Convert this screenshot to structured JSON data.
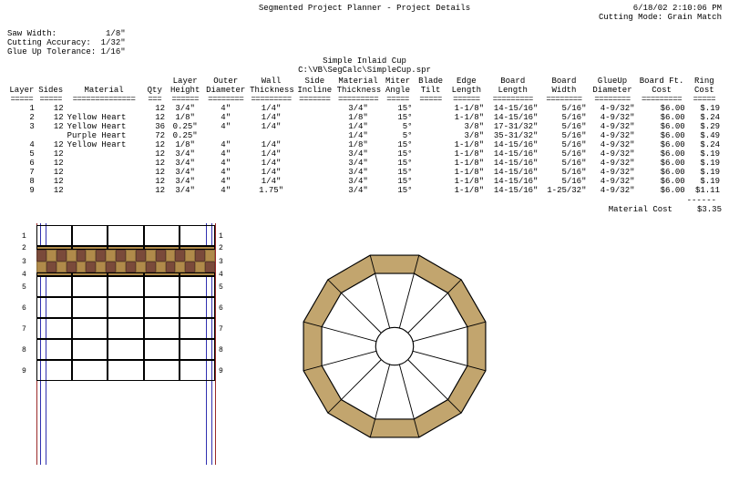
{
  "header": {
    "title": "Segmented Project Planner - Project Details",
    "datetime": "6/18/02 2:10:06 PM",
    "cutting_mode_label": "Cutting Mode:",
    "cutting_mode": "Grain Match",
    "saw_width_label": "Saw Width:",
    "saw_width": "1/8\"",
    "cut_acc_label": "Cutting Accuracy:",
    "cut_acc": "1/32\"",
    "glue_tol_label": "Glue Up Tolerance:",
    "glue_tol": "1/16\"",
    "proj_name": "Simple Inlaid Cup",
    "proj_path": "C:\\VB\\SegCalc\\SimpleCup.spr"
  },
  "columns": {
    "h1": [
      "",
      "",
      "",
      "",
      "Layer",
      "Outer",
      "Wall",
      "Side",
      "Material",
      "Miter",
      "Blade",
      "Edge",
      "Board",
      "Board",
      "GlueUp",
      "Board Ft.",
      "Ring"
    ],
    "h2": [
      "Layer",
      "Sides",
      "Material",
      "Qty",
      "Height",
      "Diameter",
      "Thickness",
      "Incline",
      "Thickness",
      "Angle",
      "Tilt",
      "Length",
      "Length",
      "Width",
      "Diameter",
      "Cost",
      "Cost"
    ]
  },
  "dashes": [
    "=====",
    "=====",
    "==============",
    "===",
    "======",
    "========",
    "=========",
    "=======",
    "=========",
    "=====",
    "=====",
    "======",
    "=========",
    "========",
    "========",
    "=========",
    "====="
  ],
  "rows": [
    {
      "c": [
        "1",
        "12",
        "",
        "12",
        "3/4\"",
        "4\"",
        "1/4\"",
        "",
        "3/4\"",
        "15°",
        "",
        "1-1/8\"",
        "14-15/16\"",
        "5/16\"",
        "4-9/32\"",
        "$6.00",
        "$.19"
      ]
    },
    {
      "c": [
        "2",
        "12",
        "Yellow Heart",
        "12",
        "1/8\"",
        "4\"",
        "1/4\"",
        "",
        "1/8\"",
        "15°",
        "",
        "1-1/8\"",
        "14-15/16\"",
        "5/16\"",
        "4-9/32\"",
        "$6.00",
        "$.24"
      ]
    },
    {
      "c": [
        "3",
        "12",
        "Yellow Heart",
        "36",
        "0.25\"",
        "4\"",
        "1/4\"",
        "",
        "1/4\"",
        "5°",
        "",
        "3/8\"",
        "17-31/32\"",
        "5/16\"",
        "4-9/32\"",
        "$6.00",
        "$.29"
      ]
    },
    {
      "c": [
        "",
        "",
        "Purple Heart",
        "72",
        "0.25\"",
        "",
        "",
        "",
        "1/4\"",
        "5°",
        "",
        "3/8\"",
        "35-31/32\"",
        "5/16\"",
        "4-9/32\"",
        "$6.00",
        "$.49"
      ]
    },
    {
      "c": [
        "4",
        "12",
        "Yellow Heart",
        "12",
        "1/8\"",
        "4\"",
        "1/4\"",
        "",
        "1/8\"",
        "15°",
        "",
        "1-1/8\"",
        "14-15/16\"",
        "5/16\"",
        "4-9/32\"",
        "$6.00",
        "$.24"
      ]
    },
    {
      "c": [
        "5",
        "12",
        "",
        "12",
        "3/4\"",
        "4\"",
        "1/4\"",
        "",
        "3/4\"",
        "15°",
        "",
        "1-1/8\"",
        "14-15/16\"",
        "5/16\"",
        "4-9/32\"",
        "$6.00",
        "$.19"
      ]
    },
    {
      "c": [
        "6",
        "12",
        "",
        "12",
        "3/4\"",
        "4\"",
        "1/4\"",
        "",
        "3/4\"",
        "15°",
        "",
        "1-1/8\"",
        "14-15/16\"",
        "5/16\"",
        "4-9/32\"",
        "$6.00",
        "$.19"
      ]
    },
    {
      "c": [
        "7",
        "12",
        "",
        "12",
        "3/4\"",
        "4\"",
        "1/4\"",
        "",
        "3/4\"",
        "15°",
        "",
        "1-1/8\"",
        "14-15/16\"",
        "5/16\"",
        "4-9/32\"",
        "$6.00",
        "$.19"
      ]
    },
    {
      "c": [
        "8",
        "12",
        "",
        "12",
        "3/4\"",
        "4\"",
        "1/4\"",
        "",
        "3/4\"",
        "15°",
        "",
        "1-1/8\"",
        "14-15/16\"",
        "5/16\"",
        "4-9/32\"",
        "$6.00",
        "$.19"
      ]
    },
    {
      "c": [
        "9",
        "12",
        "",
        "12",
        "3/4\"",
        "4\"",
        "1.75\"",
        "",
        "3/4\"",
        "15°",
        "",
        "1-1/8\"",
        "14-15/16\"",
        "1-25/32\"",
        "4-9/32\"",
        "$6.00",
        "$1.11"
      ]
    }
  ],
  "footer": {
    "dash": "------",
    "label": "Material Cost",
    "total": "$3.35"
  },
  "colors": {
    "yellow_heart": "#b08a4a",
    "purple_heart": "#7a4a3a",
    "wood_light": "#c2a56e"
  },
  "elevation": {
    "row_labels": [
      "1",
      "2",
      "3",
      "4",
      "5",
      "6",
      "7",
      "8",
      "9"
    ]
  }
}
